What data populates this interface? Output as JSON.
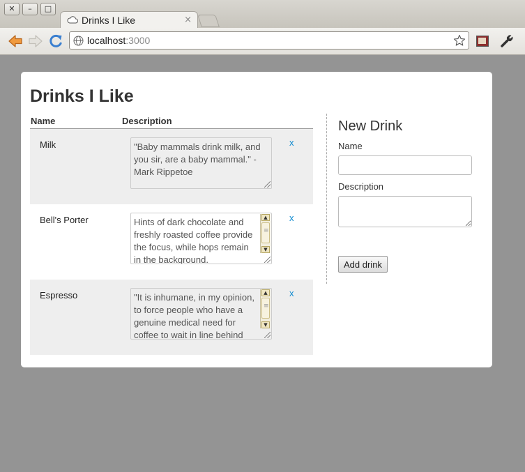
{
  "window": {
    "close_glyph": "✕",
    "minimize_glyph": "–",
    "maximize_glyph": "□"
  },
  "browser": {
    "tab_title": "Drinks I Like",
    "tab_close": "×",
    "url_host": "localhost",
    "url_port": ":3000",
    "icons": [
      "back-arrow-icon",
      "forward-arrow-icon",
      "reload-icon",
      "globe-icon",
      "bookmark-star-icon",
      "extension-icon",
      "wrench-icon"
    ]
  },
  "page": {
    "title": "Drinks I Like",
    "table": {
      "columns": [
        "Name",
        "Description"
      ],
      "rows": [
        {
          "name": "Milk",
          "description": "\"Baby mammals drink milk, and you sir, are a baby mammal.\" - Mark Rippetoe",
          "delete_label": "x"
        },
        {
          "name": "Bell's Porter",
          "description": "Hints of dark chocolate and freshly roasted coffee provide the focus, while hops remain in the background.",
          "delete_label": "x"
        },
        {
          "name": "Espresso",
          "description": "\"It is inhumane, in my opinion, to force people who have a genuine medical need for coffee to wait in line behind",
          "delete_label": "x"
        }
      ]
    },
    "new_drink": {
      "heading": "New Drink",
      "name_label": "Name",
      "name_value": "",
      "description_label": "Description",
      "description_value": "",
      "submit_label": "Add drink"
    }
  },
  "colors": {
    "page_background": "#949494",
    "card_background": "#ffffff",
    "row_alt_background": "#eeeeee",
    "link": "#0e8ad0"
  }
}
